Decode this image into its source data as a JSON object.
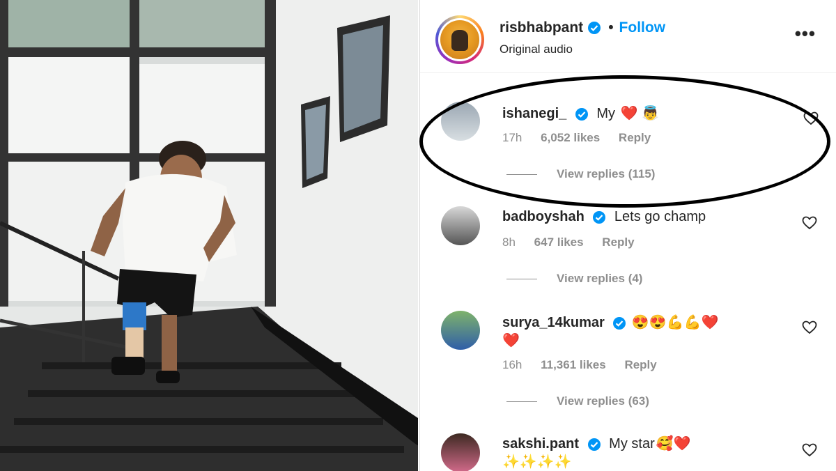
{
  "post": {
    "username": "risbhabpant",
    "follow_label": "Follow",
    "audio_label": "Original audio",
    "more_icon": "more-options-icon"
  },
  "colors": {
    "accent": "#0095f6",
    "text": "#262626",
    "muted": "#8e8e8e",
    "heart": "#ed4956"
  },
  "comments": [
    {
      "username": "ishanegi_",
      "text": "My",
      "emojis": "❤️ 👼",
      "time": "17h",
      "likes": "6,052 likes",
      "reply_label": "Reply",
      "view_replies": "View replies (115)"
    },
    {
      "username": "badboyshah",
      "text": "Lets go champ",
      "emojis": "",
      "time": "8h",
      "likes": "647 likes",
      "reply_label": "Reply",
      "view_replies": "View replies (4)"
    },
    {
      "username": "surya_14kumar",
      "text": "",
      "emojis": "😍😍💪💪❤️",
      "emojis_line2": "❤️",
      "time": "16h",
      "likes": "11,361 likes",
      "reply_label": "Reply",
      "view_replies": "View replies (63)"
    },
    {
      "username": "sakshi.pant",
      "text": "My star",
      "emojis": "🥰❤️",
      "emojis_line2": "✨✨✨✨",
      "time": "",
      "likes": "",
      "reply_label": "",
      "view_replies": ""
    }
  ]
}
